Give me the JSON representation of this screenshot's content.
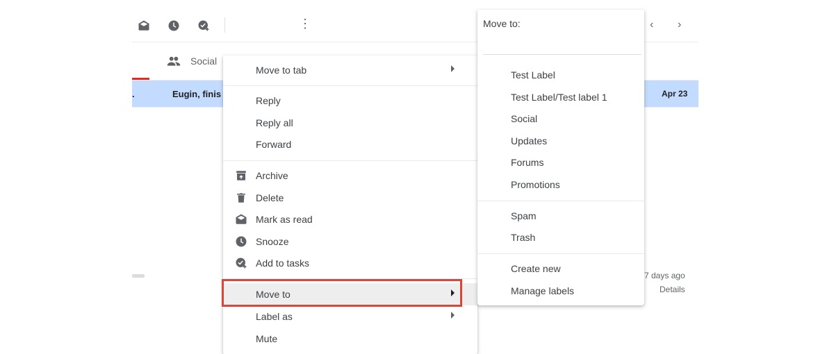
{
  "background": {
    "tab_social_label": "Social",
    "email_sender_prefix": ".",
    "email_sender": "Eugin, finis",
    "email_date": "Apr 23",
    "days_ago": "7 days ago",
    "details_label": "Details",
    "nav_prev": "‹",
    "nav_next": "›",
    "more_glyph": "⋮"
  },
  "context_menu": {
    "items": [
      {
        "label": "Move to tab",
        "icon": null,
        "submenu": true
      },
      {
        "label": "Reply",
        "icon": null
      },
      {
        "label": "Reply all",
        "icon": null
      },
      {
        "label": "Forward",
        "icon": null
      },
      {
        "label": "Archive",
        "icon": "archive-icon"
      },
      {
        "label": "Delete",
        "icon": "trash-icon"
      },
      {
        "label": "Mark as read",
        "icon": "envelope-open-icon"
      },
      {
        "label": "Snooze",
        "icon": "clock-icon"
      },
      {
        "label": "Add to tasks",
        "icon": "add-task-icon"
      },
      {
        "label": "Move to",
        "icon": null,
        "submenu": true,
        "highlighted": true
      },
      {
        "label": "Label as",
        "icon": null,
        "submenu": true
      },
      {
        "label": "Mute",
        "icon": null
      }
    ]
  },
  "move_to_menu": {
    "title": "Move to:",
    "search_value": "",
    "labels": [
      "Test Label",
      "Test Label/Test label 1",
      "Social",
      "Updates",
      "Forums",
      "Promotions"
    ],
    "system": [
      "Spam",
      "Trash"
    ],
    "actions": [
      "Create new",
      "Manage labels"
    ]
  },
  "colors": {
    "selected_row": "#c2dbff",
    "highlight_box": "#d9473c",
    "icon_gray": "#5f6368"
  }
}
